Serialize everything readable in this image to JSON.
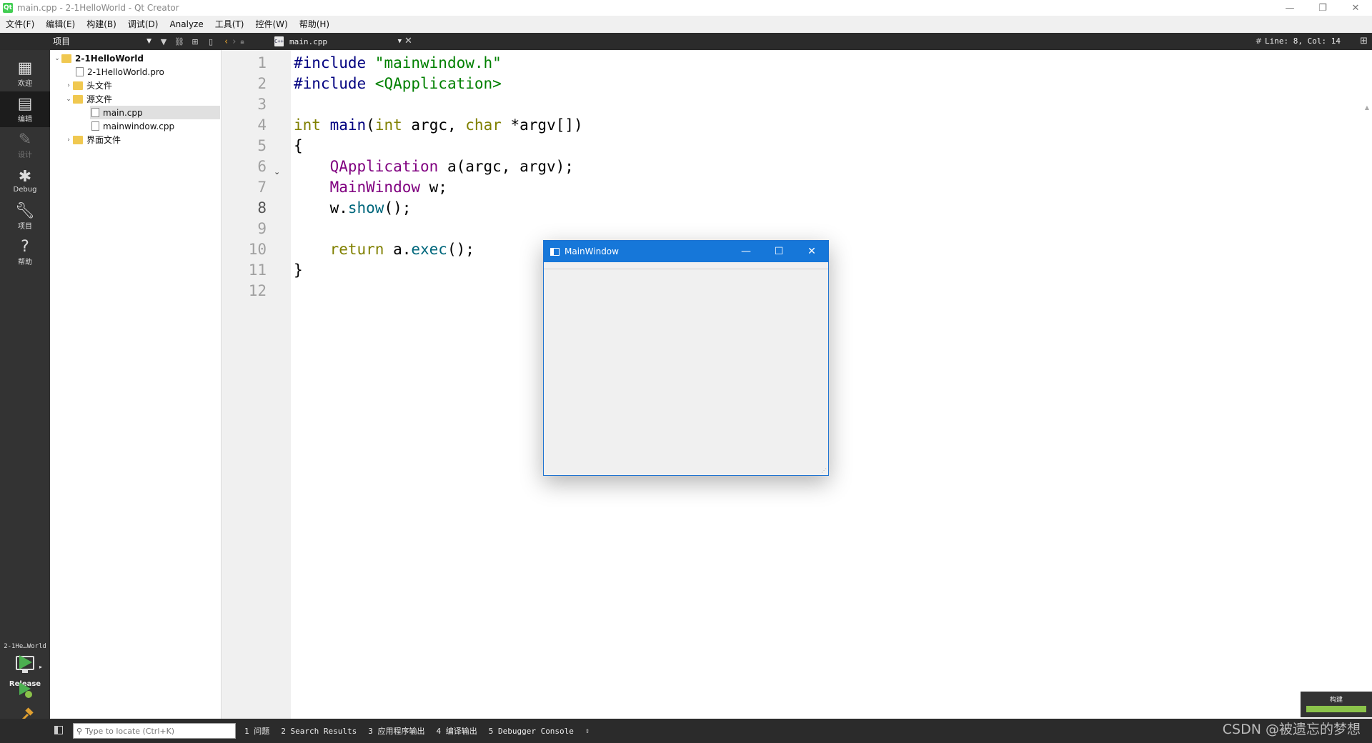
{
  "window": {
    "title": "main.cpp - 2-1HelloWorld - Qt Creator",
    "controls": {
      "minimize": "—",
      "restore": "❐",
      "close": "✕"
    }
  },
  "menu": [
    "文件(F)",
    "编辑(E)",
    "构建(B)",
    "调试(D)",
    "Analyze",
    "工具(T)",
    "控件(W)",
    "帮助(H)"
  ],
  "toolbar": {
    "project_combo": "项目",
    "file_tab": "main.cpp",
    "file_icon_text": "C++",
    "line_info": "Line: 8, Col: 14",
    "hash": "#"
  },
  "modes": [
    {
      "label": "欢迎",
      "icon": "grid-icon"
    },
    {
      "label": "编辑",
      "icon": "edit-icon"
    },
    {
      "label": "设计",
      "icon": "pen-icon"
    },
    {
      "label": "Debug",
      "icon": "bug-icon"
    },
    {
      "label": "项目",
      "icon": "wrench-icon"
    },
    {
      "label": "帮助",
      "icon": "help-icon"
    }
  ],
  "kit": {
    "name": "2-1He…World",
    "config": "Release"
  },
  "tree": [
    {
      "label": "2-1HelloWorld",
      "level": 0,
      "caret": "⌄",
      "icon": "project-icon"
    },
    {
      "label": "2-1HelloWorld.pro",
      "level": 1,
      "caret": "",
      "icon": "pro-file-icon"
    },
    {
      "label": "头文件",
      "level": 1,
      "caret": "›",
      "icon": "header-folder-icon"
    },
    {
      "label": "源文件",
      "level": 1,
      "caret": "⌄",
      "icon": "source-folder-icon"
    },
    {
      "label": "main.cpp",
      "level": 2,
      "caret": "",
      "icon": "cpp-file-icon",
      "selected": true
    },
    {
      "label": "mainwindow.cpp",
      "level": 2,
      "caret": "",
      "icon": "cpp-file-icon"
    },
    {
      "label": "界面文件",
      "level": 1,
      "caret": "›",
      "icon": "forms-folder-icon"
    }
  ],
  "editor": {
    "line_numbers": [
      "1",
      "2",
      "3",
      "4",
      "5",
      "6",
      "7",
      "8",
      "9",
      "10",
      "11",
      "12"
    ],
    "current_line": 8,
    "lines": [
      [
        {
          "t": "#include ",
          "c": "pre"
        },
        {
          "t": "\"mainwindow.h\"",
          "c": "str"
        }
      ],
      [
        {
          "t": "#include ",
          "c": "pre"
        },
        {
          "t": "<QApplication>",
          "c": "str"
        }
      ],
      [],
      [
        {
          "t": "int",
          "c": "type"
        },
        {
          "t": " ",
          "c": ""
        },
        {
          "t": "main",
          "c": "pre"
        },
        {
          "t": "(",
          "c": ""
        },
        {
          "t": "int",
          "c": "type"
        },
        {
          "t": " argc, ",
          "c": ""
        },
        {
          "t": "char",
          "c": "type"
        },
        {
          "t": " *argv[])",
          "c": ""
        }
      ],
      [
        {
          "t": "{",
          "c": ""
        }
      ],
      [
        {
          "t": "    ",
          "c": ""
        },
        {
          "t": "QApplication",
          "c": "cls"
        },
        {
          "t": " a(argc, argv);",
          "c": ""
        }
      ],
      [
        {
          "t": "    ",
          "c": ""
        },
        {
          "t": "MainWindow",
          "c": "cls"
        },
        {
          "t": " w;",
          "c": ""
        }
      ],
      [
        {
          "t": "    w.",
          "c": ""
        },
        {
          "t": "show",
          "c": "fn"
        },
        {
          "t": "();",
          "c": ""
        }
      ],
      [],
      [
        {
          "t": "    ",
          "c": ""
        },
        {
          "t": "return",
          "c": "type"
        },
        {
          "t": " a.",
          "c": ""
        },
        {
          "t": "exec",
          "c": "fn"
        },
        {
          "t": "();",
          "c": ""
        }
      ],
      [
        {
          "t": "}",
          "c": ""
        }
      ],
      []
    ]
  },
  "popup": {
    "title": "MainWindow",
    "controls": {
      "minimize": "—",
      "maximize": "☐",
      "close": "✕"
    }
  },
  "build": {
    "label": "构建",
    "progress": 1.0,
    "color": "#8bc34a"
  },
  "status": {
    "locator_placeholder": "Type to locate (Ctrl+K)",
    "tabs": [
      "1 问题",
      "2 Search Results",
      "3 应用程序输出",
      "4 编译输出",
      "5 Debugger Console"
    ],
    "more": "⇕"
  },
  "watermark": "CSDN @被遗忘的梦想"
}
